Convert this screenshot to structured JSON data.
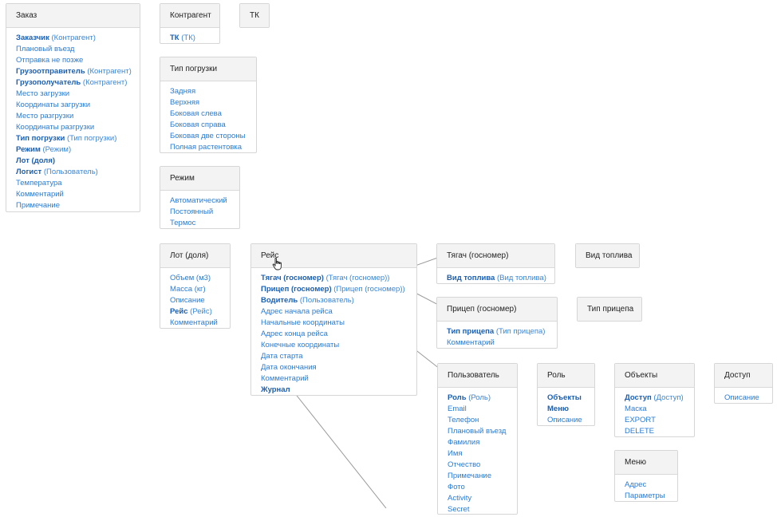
{
  "cards": [
    {
      "id": "zakaz",
      "title": "Заказ",
      "fields": [
        {
          "label": "Заказчик",
          "ref": "(Контрагент)",
          "bold": true
        },
        {
          "label": "Плановый въезд"
        },
        {
          "label": "Отправка не позже"
        },
        {
          "label": "Грузоотправитель",
          "ref": "(Контрагент)",
          "bold": true
        },
        {
          "label": "Грузополучатель",
          "ref": "(Контрагент)",
          "bold": true
        },
        {
          "label": "Место загрузки"
        },
        {
          "label": "Координаты загрузки"
        },
        {
          "label": "Место разгрузки"
        },
        {
          "label": "Координаты разгрузки"
        },
        {
          "label": "Тип погрузки",
          "ref": "(Тип погрузки)",
          "bold": true
        },
        {
          "label": "Режим",
          "ref": "(Режим)",
          "bold": true
        },
        {
          "label": "Лот (доля)",
          "bold": true
        },
        {
          "label": "Логист",
          "ref": "(Пользователь)",
          "bold": true
        },
        {
          "label": "Температура"
        },
        {
          "label": "Комментарий"
        },
        {
          "label": "Примечание"
        }
      ]
    },
    {
      "id": "kontragent",
      "title": "Контрагент",
      "fields": [
        {
          "label": "ТК",
          "ref": "(ТК)",
          "bold": true
        }
      ]
    },
    {
      "id": "tk",
      "title": "ТК",
      "fields": []
    },
    {
      "id": "tip_pogruzki",
      "title": "Тип погрузки",
      "fields": [
        {
          "label": "Задняя"
        },
        {
          "label": "Верхняя"
        },
        {
          "label": "Боковая слева"
        },
        {
          "label": "Боковая справа"
        },
        {
          "label": "Боковая две стороны"
        },
        {
          "label": "Полная растентовка"
        }
      ]
    },
    {
      "id": "rezhim",
      "title": "Режим",
      "fields": [
        {
          "label": "Автоматический"
        },
        {
          "label": "Постоянный"
        },
        {
          "label": "Термос"
        }
      ]
    },
    {
      "id": "lot",
      "title": "Лот (доля)",
      "fields": [
        {
          "label": "Объем (м3)"
        },
        {
          "label": "Масса (кг)"
        },
        {
          "label": "Описание"
        },
        {
          "label": "Рейс",
          "ref": "(Рейс)",
          "bold": true
        },
        {
          "label": "Комментарий"
        }
      ]
    },
    {
      "id": "reis",
      "title": "Рейс",
      "fields": [
        {
          "label": "Тягач (госномер)",
          "ref": "(Тягач (госномер))",
          "bold": true
        },
        {
          "label": "Прицеп (госномер)",
          "ref": "(Прицеп (госномер))",
          "bold": true
        },
        {
          "label": "Водитель",
          "ref": "(Пользователь)",
          "bold": true
        },
        {
          "label": "Адрес начала рейса"
        },
        {
          "label": "Начальные координаты"
        },
        {
          "label": "Адрес конца рейса"
        },
        {
          "label": "Конечные координаты"
        },
        {
          "label": "Дата старта"
        },
        {
          "label": "Дата окончания"
        },
        {
          "label": "Комментарий"
        },
        {
          "label": "Журнал",
          "bold": true
        }
      ]
    },
    {
      "id": "tyagach",
      "title": "Тягач (госномер)",
      "fields": [
        {
          "label": "Вид топлива",
          "ref": "(Вид топлива)",
          "bold": true
        }
      ]
    },
    {
      "id": "vid_topliva",
      "title": "Вид топлива",
      "fields": []
    },
    {
      "id": "pricep",
      "title": "Прицеп (госномер)",
      "fields": [
        {
          "label": "Тип прицепа",
          "ref": "(Тип прицепа)",
          "bold": true
        },
        {
          "label": "Комментарий"
        }
      ]
    },
    {
      "id": "tip_pricepa",
      "title": "Тип прицепа",
      "fields": []
    },
    {
      "id": "polzovatel",
      "title": "Пользователь",
      "fields": [
        {
          "label": "Роль",
          "ref": "(Роль)",
          "bold": true
        },
        {
          "label": "Email"
        },
        {
          "label": "Телефон"
        },
        {
          "label": "Плановый въезд"
        },
        {
          "label": "Фамилия"
        },
        {
          "label": "Имя"
        },
        {
          "label": "Отчество"
        },
        {
          "label": "Примечание"
        },
        {
          "label": "Фото"
        },
        {
          "label": "Activity"
        },
        {
          "label": "Secret"
        }
      ]
    },
    {
      "id": "rol",
      "title": "Роль",
      "fields": [
        {
          "label": "Объекты",
          "bold": true
        },
        {
          "label": "Меню",
          "bold": true
        },
        {
          "label": "Описание"
        }
      ]
    },
    {
      "id": "obekty",
      "title": "Объекты",
      "fields": [
        {
          "label": "Доступ",
          "ref": "(Доступ)",
          "bold": true
        },
        {
          "label": "Маска"
        },
        {
          "label": "EXPORT"
        },
        {
          "label": "DELETE"
        }
      ]
    },
    {
      "id": "dostup",
      "title": "Доступ",
      "fields": [
        {
          "label": "Описание"
        }
      ]
    },
    {
      "id": "menyu",
      "title": "Меню",
      "fields": [
        {
          "label": "Адрес"
        },
        {
          "label": "Параметры"
        }
      ]
    }
  ],
  "colors": {
    "link": "#2a7bd4",
    "link_bold": "#1b5fb3",
    "arrow": "#999999",
    "header_bg": "#f3f3f3"
  }
}
